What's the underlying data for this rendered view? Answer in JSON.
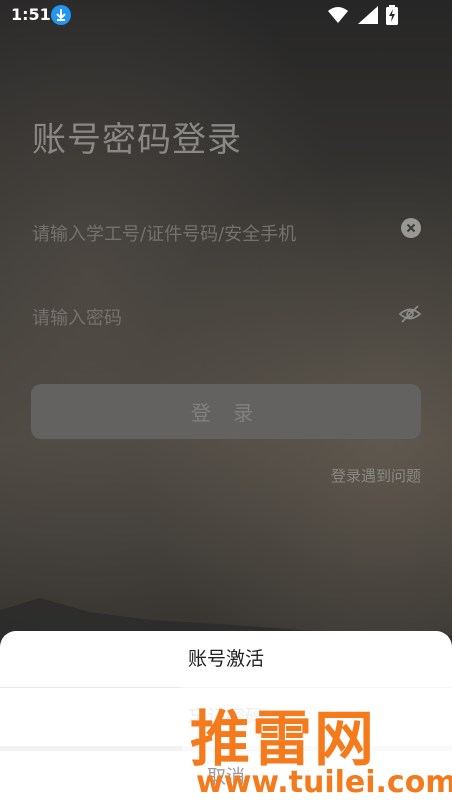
{
  "status_bar": {
    "time": "1:51",
    "icons": [
      "download-icon",
      "wifi-icon",
      "signal-icon",
      "battery-charging-icon"
    ]
  },
  "login": {
    "title": "账号密码登录",
    "account_placeholder": "请输入学工号/证件号码/安全手机",
    "password_placeholder": "请输入密码",
    "login_button": "登 录",
    "help_link": "登录遇到问题"
  },
  "sheet": {
    "items": [
      "账号激活",
      "忘记密码",
      "取消"
    ]
  },
  "watermark": {
    "brand": "推雷网",
    "url": "www.tuilei.com"
  },
  "colors": {
    "download_badge": "#2196f3",
    "login_button_bg": "#636260",
    "watermark": "#f47a1c"
  }
}
